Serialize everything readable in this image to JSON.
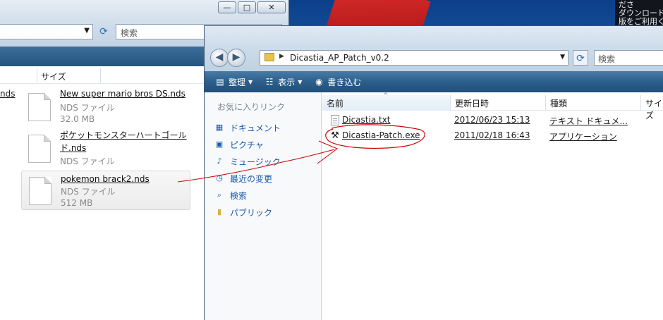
{
  "desktop": {
    "notice_lines": [
      "ださ",
      "ダウンロード",
      "版をご利用く"
    ]
  },
  "back_window": {
    "caption": {
      "minimize": "—",
      "maximize": "□",
      "close": "✕"
    },
    "search_placeholder": "検索",
    "column_size": "サイズ",
    "partial_item": "nds",
    "files": [
      {
        "name": "New super mario bros DS.nds",
        "type": "NDS ファイル",
        "size": "32.0 MB"
      },
      {
        "name": "ポケットモンスターハートゴールド.nds",
        "type": "NDS ファイル",
        "size": ""
      },
      {
        "name": "pokemon brack2.nds",
        "type": "NDS ファイル",
        "size": "512 MB"
      }
    ]
  },
  "front_window": {
    "address": "Dicastia_AP_Patch_v0.2",
    "search_placeholder": "検索",
    "toolbar": {
      "organize": "整理",
      "view": "表示",
      "burn": "書き込む"
    },
    "nav": {
      "title": "お気に入りリンク",
      "items": [
        "ドキュメント",
        "ピクチャ",
        "ミュージック",
        "最近の変更",
        "検索",
        "パブリック"
      ]
    },
    "columns": {
      "name": "名前",
      "modified": "更新日時",
      "type": "種類",
      "size": "サイズ"
    },
    "files": [
      {
        "name": "Dicastia.txt",
        "modified": "2012/06/23 15:13",
        "type": "テキスト ドキュメ..."
      },
      {
        "name": "Dicastia-Patch.exe",
        "modified": "2011/02/18 16:43",
        "type": "アプリケーション"
      }
    ]
  },
  "colors": {
    "toolbar": "#2b5f8c",
    "link": "#1b5ba8",
    "annotation": "#d40000"
  }
}
